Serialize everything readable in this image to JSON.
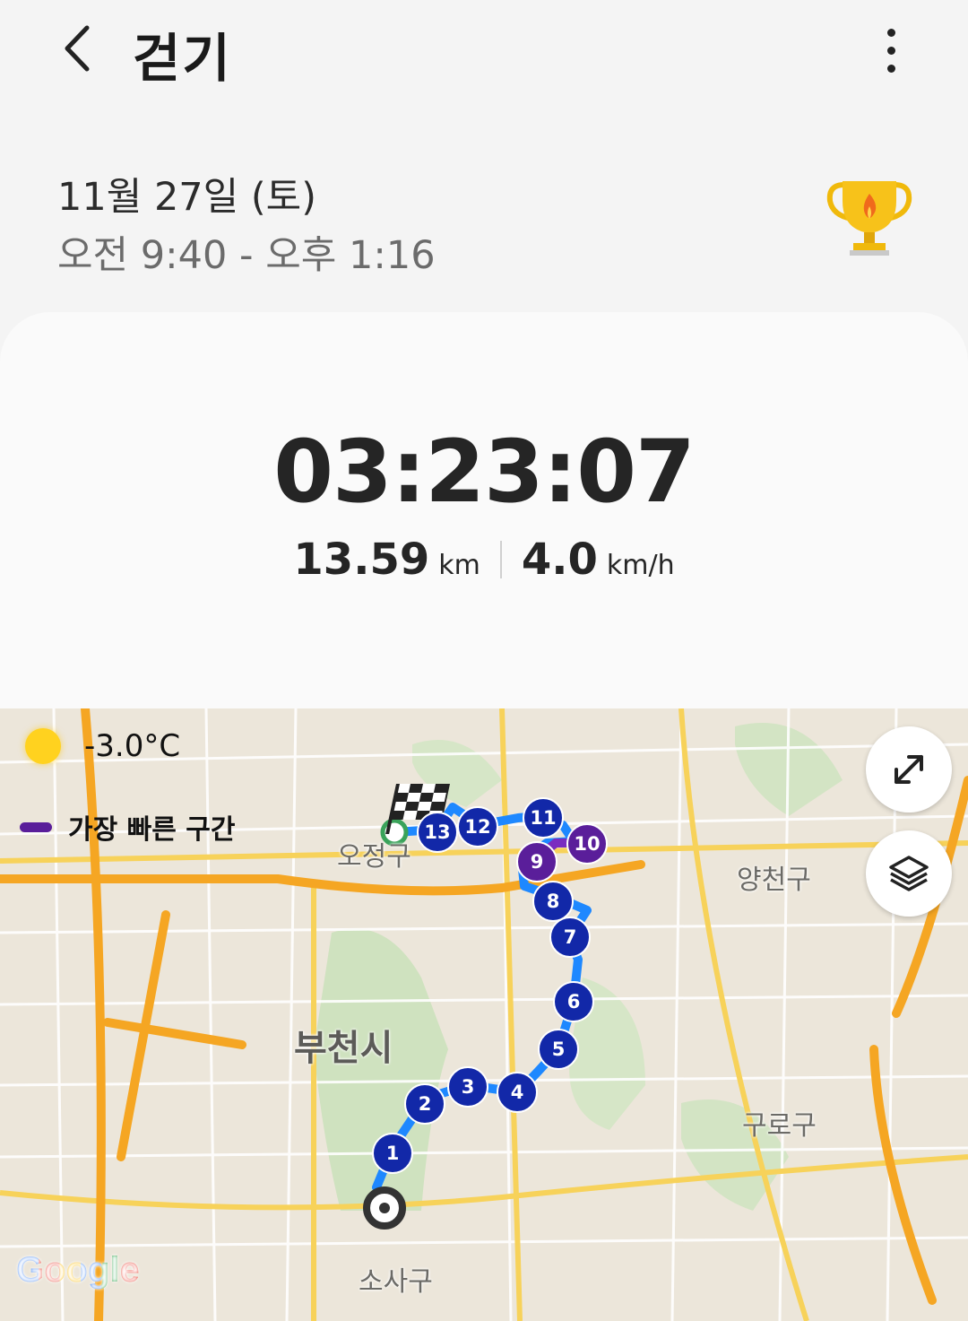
{
  "header": {
    "title": "걷기",
    "back_icon": "chevron-left-icon",
    "menu_icon": "more-vert-icon"
  },
  "session": {
    "date": "11월 27일 (토)",
    "time_range": "오전 9:40 - 오후 1:16",
    "badge_icon": "trophy-icon"
  },
  "summary": {
    "duration": "03:23:07",
    "distance_value": "13.59",
    "distance_unit": "km",
    "speed_value": "4.0",
    "speed_unit": "km/h"
  },
  "map": {
    "weather_icon": "sun-icon",
    "temperature": "-3.0°C",
    "legend_label": "가장 빠른 구간",
    "legend_color": "#5a1e9a",
    "route_color": "#1a73e8",
    "lap_marker_color": "#1228a8",
    "fast_marker_color": "#5a1e9a",
    "places": {
      "ojeong": "오정구",
      "yangcheon": "양천구",
      "bucheon": "부천시",
      "guro": "구로구",
      "sosa": "소사구"
    },
    "laps": [
      "1",
      "2",
      "3",
      "4",
      "5",
      "6",
      "7",
      "8",
      "9",
      "10",
      "11",
      "12",
      "13"
    ],
    "fast_laps": [
      "9",
      "10"
    ],
    "expand_icon": "expand-icon",
    "layers_icon": "layers-icon",
    "attribution": "Google"
  }
}
